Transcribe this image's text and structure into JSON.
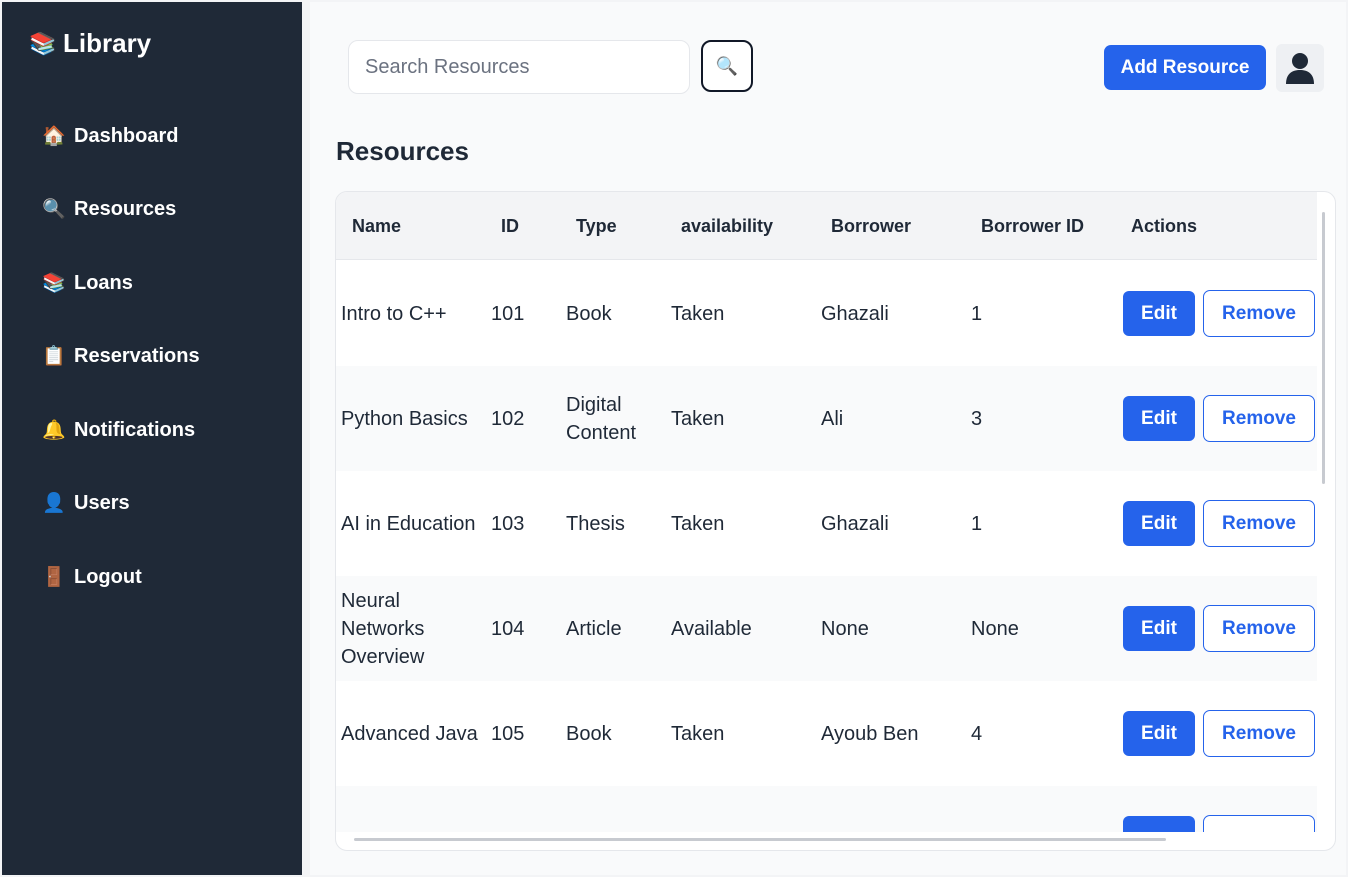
{
  "sidebar": {
    "brand": {
      "icon": "books-icon",
      "glyph": "📚",
      "title": "Library"
    },
    "items": [
      {
        "key": "dashboard",
        "icon": "house-icon",
        "glyph": "🏠",
        "label": "Dashboard"
      },
      {
        "key": "resources",
        "icon": "magnifier-icon",
        "glyph": "🔍",
        "label": "Resources"
      },
      {
        "key": "loans",
        "icon": "books-icon",
        "glyph": "📚",
        "label": "Loans"
      },
      {
        "key": "reservations",
        "icon": "clipboard-icon",
        "glyph": "📋",
        "label": "Reservations"
      },
      {
        "key": "notifications",
        "icon": "bell-icon",
        "glyph": "🔔",
        "label": "Notifications"
      },
      {
        "key": "users",
        "icon": "user-icon",
        "glyph": "👤",
        "label": "Users"
      },
      {
        "key": "logout",
        "icon": "door-icon",
        "glyph": "🚪",
        "label": "Logout"
      }
    ]
  },
  "header": {
    "search_placeholder": "Search Resources",
    "search_button_glyph": "🔍",
    "add_label": "Add Resource"
  },
  "page": {
    "title": "Resources"
  },
  "table": {
    "columns": [
      "Name",
      "ID",
      "Type",
      "availability",
      "Borrower",
      "Borrower ID",
      "Actions"
    ],
    "rows": [
      {
        "name": "Intro to C++",
        "id": "101",
        "type": "Book",
        "availability": "Taken",
        "borrower": "Ghazali",
        "borrower_id": "1"
      },
      {
        "name": "Python Basics",
        "id": "102",
        "type": "Digital Content",
        "availability": "Taken",
        "borrower": "Ali",
        "borrower_id": "3"
      },
      {
        "name": "AI in Education",
        "id": "103",
        "type": "Thesis",
        "availability": "Taken",
        "borrower": "Ghazali",
        "borrower_id": "1"
      },
      {
        "name": "Neural Networks Overview",
        "id": "104",
        "type": "Article",
        "availability": "Available",
        "borrower": "None",
        "borrower_id": "None"
      },
      {
        "name": "Advanced Java",
        "id": "105",
        "type": "Book",
        "availability": "Taken",
        "borrower": "Ayoub Ben",
        "borrower_id": "4"
      },
      {
        "name": "",
        "id": "",
        "type": "",
        "availability": "",
        "borrower": "",
        "borrower_id": ""
      }
    ],
    "edit_label": "Edit",
    "remove_label": "Remove"
  },
  "colors": {
    "sidebar_bg": "#1f2937",
    "accent": "#2563eb",
    "page_bg": "#f9fafb"
  }
}
